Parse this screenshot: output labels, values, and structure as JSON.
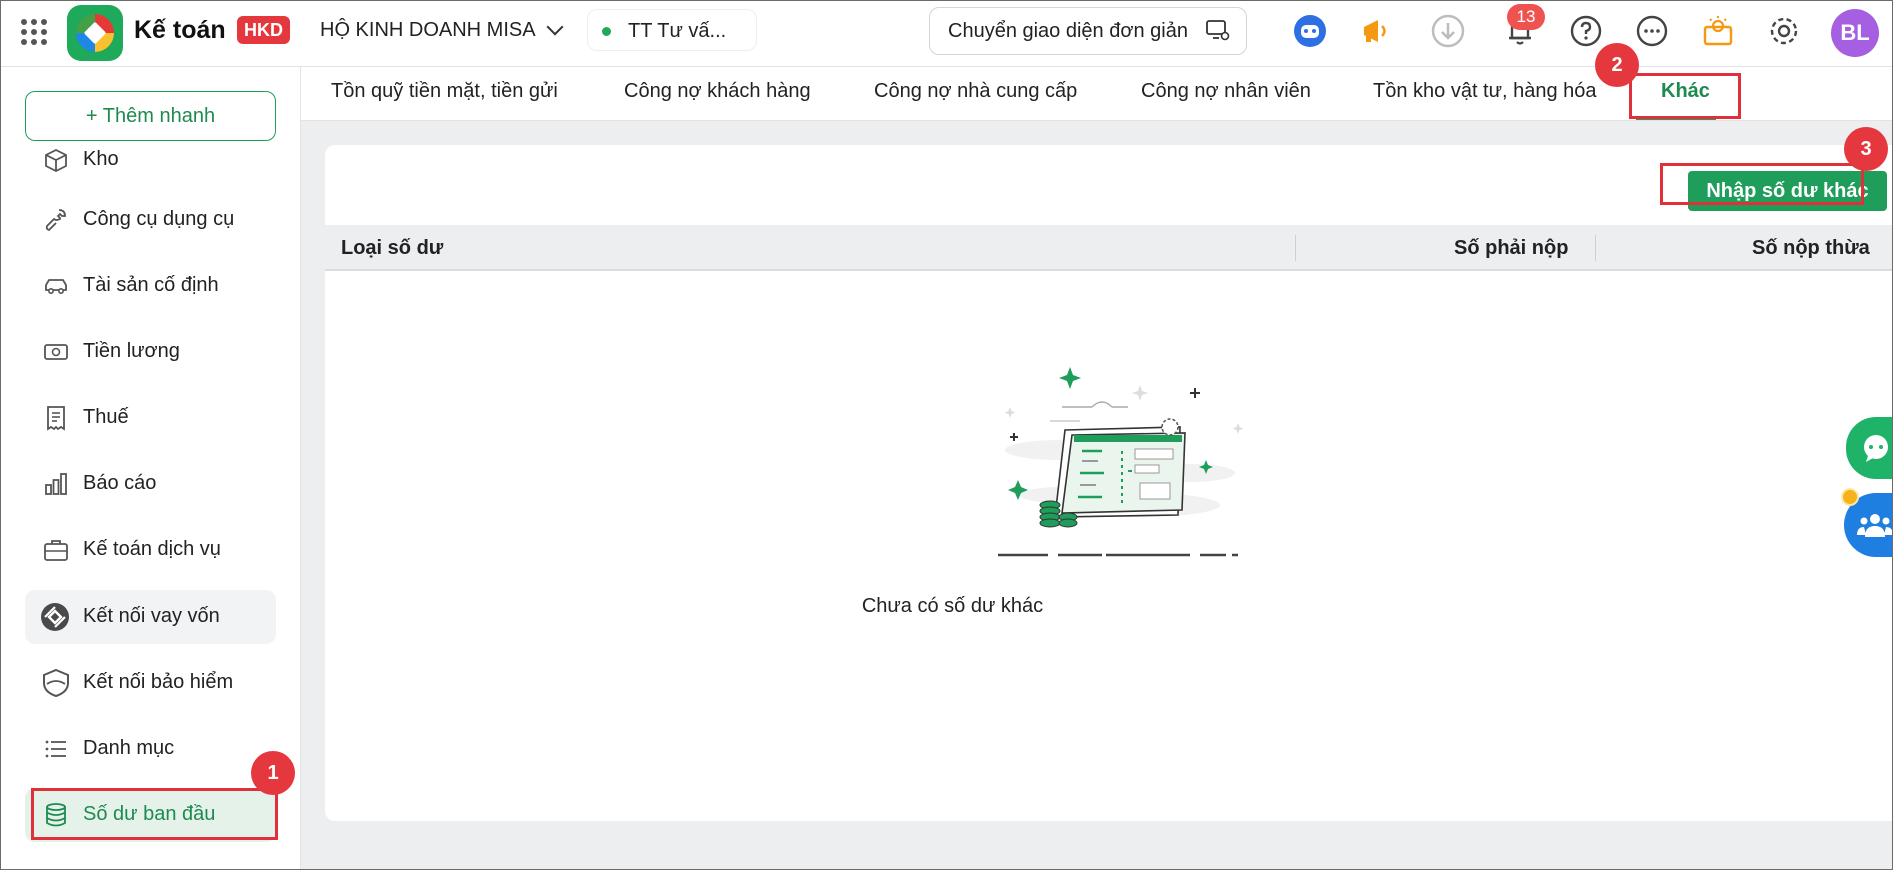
{
  "header": {
    "app_title": "Kế toán",
    "app_badge": "HKD",
    "organization": "HỘ KINH DOANH MISA",
    "status_text": "TT Tư vấ...",
    "simple_mode_label": "Chuyển giao diện đơn giản",
    "notification_count": "13",
    "avatar_initials": "BL",
    "accent_color": "#1f9d5b"
  },
  "sidebar": {
    "quick_add_label": "+ Thêm nhanh",
    "items": [
      {
        "label": "Kho",
        "icon": "box-icon"
      },
      {
        "label": "Công cụ dụng cụ",
        "icon": "wrench-icon"
      },
      {
        "label": "Tài sản cố định",
        "icon": "car-icon"
      },
      {
        "label": "Tiền lương",
        "icon": "money-icon"
      },
      {
        "label": "Thuế",
        "icon": "receipt-icon"
      },
      {
        "label": "Báo cáo",
        "icon": "bar-chart-icon"
      },
      {
        "label": "Kế toán dịch vụ",
        "icon": "briefcase-icon"
      },
      {
        "label": "Kết nối vay vốn",
        "icon": "link-loan-icon"
      },
      {
        "label": "Kết nối bảo hiểm",
        "icon": "shield-icon"
      },
      {
        "label": "Danh mục",
        "icon": "list-icon"
      },
      {
        "label": "Số dư ban đầu",
        "icon": "database-icon"
      }
    ]
  },
  "tabs": [
    {
      "label": "Tồn quỹ tiền mặt, tiền gửi"
    },
    {
      "label": "Công nợ khách hàng"
    },
    {
      "label": "Công nợ nhà cung cấp"
    },
    {
      "label": "Công nợ nhân viên"
    },
    {
      "label": "Tồn kho vật tư, hàng hóa"
    },
    {
      "label": "Khác"
    }
  ],
  "main": {
    "add_button_label": "Nhập số dư khác",
    "columns": [
      "Loại số dư",
      "Số phải nộp",
      "Số nộp thừa"
    ],
    "empty_text": "Chưa có số dư khác"
  },
  "annotations": {
    "step1": "1",
    "step2": "2",
    "step3": "3"
  }
}
